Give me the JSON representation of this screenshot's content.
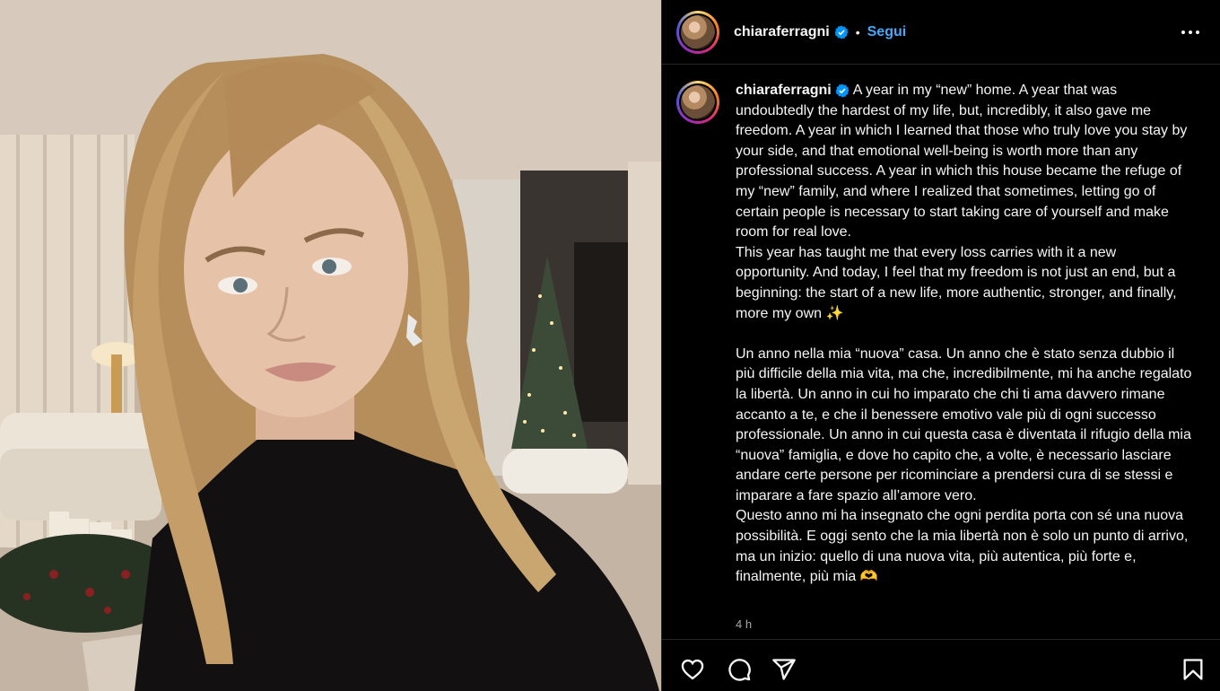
{
  "post": {
    "username": "chiaraferragni",
    "follow_label": "Segui",
    "separator": "•",
    "caption": "A year in my “new” home. A year that was undoubtedly the hardest of my life, but, incredibly, it also gave me freedom. A year in which I learned that those who truly love you stay by your side, and that emotional well-being is worth more than any professional success. A year in which this house became the refuge of my “new” family, and where I realized that sometimes, letting go of certain people is necessary to start taking care of yourself and make room for real love.\nThis year has taught me that every loss carries with it a new opportunity. And today, I feel that my freedom is not just an end, but a beginning: the start of a new life, more authentic, stronger, and finally, more my own ✨\n\nUn anno nella mia “nuova” casa. Un anno che è stato senza dubbio il più difficile della mia vita, ma che, incredibilmente, mi ha anche regalato la libertà. Un anno in cui ho imparato che chi ti ama davvero rimane accanto a te, e che il benessere emotivo vale più di ogni successo professionale. Un anno in cui questa casa è diventata il rifugio della mia “nuova” famiglia, e dove ho capito che, a volte, è necessario lasciare andare certe persone per ricominciare a prendersi cura di se stessi e imparare a fare spazio all’amore vero.\nQuesto anno mi ha insegnato che ogni perdita porta con sé una nuova possibilità. E oggi sento che la mia libertà non è solo un punto di arrivo, ma un inizio: quello di una nuova vita, più autentica, più forte e, finalmente, più mia 🫶",
    "time_ago": "4 h"
  },
  "icons": {
    "verified": "verified-badge-icon",
    "more": "more-options-icon",
    "like": "heart-icon",
    "comment": "comment-icon",
    "share": "share-icon",
    "save": "bookmark-icon"
  },
  "colors": {
    "background": "#000000",
    "text": "#f5f5f5",
    "follow": "#4aa7f8",
    "verified": "#0095f6",
    "muted": "#a8a8a8",
    "divider": "#262626"
  }
}
